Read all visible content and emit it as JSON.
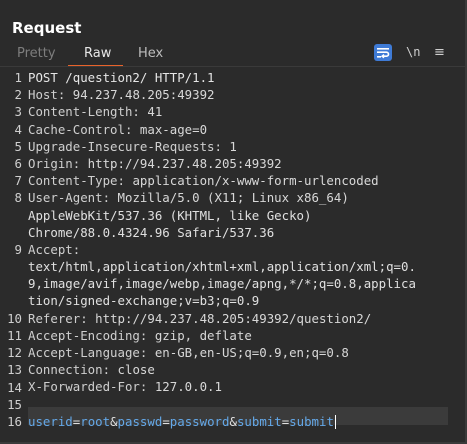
{
  "panel": {
    "title": "Request"
  },
  "tabs": [
    {
      "label": "Pretty",
      "active": false
    },
    {
      "label": "Raw",
      "active": true
    },
    {
      "label": "Hex",
      "active": false
    }
  ],
  "toolbar": {
    "wrap_icon": "wrap-lines-icon",
    "newline_label": "\\n",
    "menu_label": "≡"
  },
  "colors": {
    "accent_tab": "#e8632b",
    "wrap_button": "#3f7bd6",
    "param_highlight": "#64a8e8",
    "background": "#2b2b2b"
  },
  "lines": [
    {
      "num": "1",
      "text": "POST /question2/ HTTP/1.1"
    },
    {
      "num": "2",
      "name": "Host:",
      "value": " 94.237.48.205:49392"
    },
    {
      "num": "3",
      "name": "Content-Length:",
      "value": " 41"
    },
    {
      "num": "4",
      "name": "Cache-Control:",
      "value": " max-age=0"
    },
    {
      "num": "5",
      "name": "Upgrade-Insecure-Requests:",
      "value": " 1"
    },
    {
      "num": "6",
      "name": "Origin:",
      "value": " http://94.237.48.205:49392"
    },
    {
      "num": "7",
      "name": "Content-Type:",
      "value": " application/x-www-form-urlencoded"
    },
    {
      "num": "8",
      "name": "User-Agent:",
      "value": " Mozilla/5.0 (X11; Linux x86_64)"
    },
    {
      "num": "",
      "text": "AppleWebKit/537.36 (KHTML, like Gecko)"
    },
    {
      "num": "",
      "text": "Chrome/88.0.4324.96 Safari/537.36"
    },
    {
      "num": "9",
      "name": "Accept:",
      "value": ""
    },
    {
      "num": "",
      "text": "text/html,application/xhtml+xml,application/xml;q=0."
    },
    {
      "num": "",
      "text": "9,image/avif,image/webp,image/apng,*/*;q=0.8,applica"
    },
    {
      "num": "",
      "text": "tion/signed-exchange;v=b3;q=0.9"
    },
    {
      "num": "10",
      "name": "Referer:",
      "value": " http://94.237.48.205:49392/question2/"
    },
    {
      "num": "11",
      "name": "Accept-Encoding:",
      "value": " gzip, deflate"
    },
    {
      "num": "12",
      "name": "Accept-Language:",
      "value": " en-GB,en-US;q=0.9,en;q=0.8"
    },
    {
      "num": "13",
      "name": "Connection:",
      "value": " close"
    },
    {
      "num": "14",
      "name": "X-Forwarded-For:",
      "value": " 127.0.0.1"
    },
    {
      "num": "15",
      "text": ""
    }
  ],
  "body_line": {
    "num": "16",
    "params": [
      {
        "name": "userid",
        "value": "root"
      },
      {
        "name": "passwd",
        "value": "password"
      },
      {
        "name": "submit",
        "value": "submit"
      }
    ],
    "eq": "=",
    "amp": "&"
  }
}
